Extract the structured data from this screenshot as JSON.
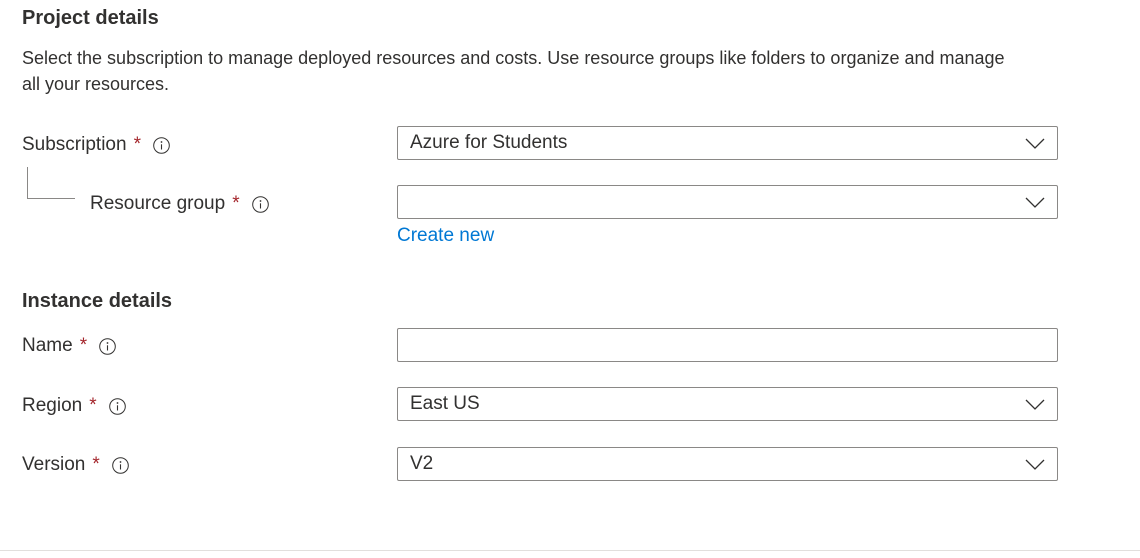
{
  "project": {
    "title": "Project details",
    "description": "Select the subscription to manage deployed resources and costs. Use resource groups like folders to organize and manage all your resources.",
    "subscription": {
      "label": "Subscription",
      "required_mark": "*",
      "value": "Azure for Students"
    },
    "resource_group": {
      "label": "Resource group",
      "required_mark": "*",
      "value": "",
      "create_new_label": "Create new"
    }
  },
  "instance": {
    "title": "Instance details",
    "name": {
      "label": "Name",
      "required_mark": "*",
      "value": ""
    },
    "region": {
      "label": "Region",
      "required_mark": "*",
      "value": "East US"
    },
    "version": {
      "label": "Version",
      "required_mark": "*",
      "value": "V2"
    }
  },
  "colors": {
    "required": "#a4262c",
    "link": "#0078d4",
    "border": "#8a8886",
    "text": "#323130"
  },
  "icons": {
    "info": "info-icon",
    "dropdown": "chevron-down-icon"
  }
}
